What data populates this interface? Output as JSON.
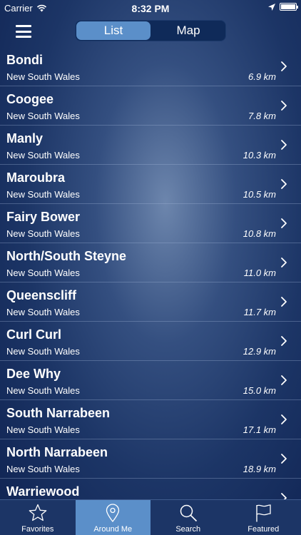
{
  "status": {
    "carrier": "Carrier",
    "time": "8:32 PM"
  },
  "nav": {
    "segments": [
      {
        "label": "List",
        "active": true
      },
      {
        "label": "Map",
        "active": false
      }
    ]
  },
  "beaches": [
    {
      "name": "Bondi",
      "region": "New South Wales",
      "distance": "6.9 km"
    },
    {
      "name": "Coogee",
      "region": "New South Wales",
      "distance": "7.8 km"
    },
    {
      "name": "Manly",
      "region": "New South Wales",
      "distance": "10.3 km"
    },
    {
      "name": "Maroubra",
      "region": "New South Wales",
      "distance": "10.5 km"
    },
    {
      "name": "Fairy Bower",
      "region": "New South Wales",
      "distance": "10.8 km"
    },
    {
      "name": "North/South Steyne",
      "region": "New South Wales",
      "distance": "11.0 km"
    },
    {
      "name": "Queenscliff",
      "region": "New South Wales",
      "distance": "11.7 km"
    },
    {
      "name": "Curl Curl",
      "region": "New South Wales",
      "distance": "12.9 km"
    },
    {
      "name": "Dee Why",
      "region": "New South Wales",
      "distance": "15.0 km"
    },
    {
      "name": "South Narrabeen",
      "region": "New South Wales",
      "distance": "17.1 km"
    },
    {
      "name": "North Narrabeen",
      "region": "New South Wales",
      "distance": "18.9 km"
    },
    {
      "name": "Warriewood",
      "region": "",
      "distance": ""
    }
  ],
  "tabs": [
    {
      "label": "Favorites",
      "icon": "star-icon",
      "active": false
    },
    {
      "label": "Around Me",
      "icon": "location-pin-icon",
      "active": true
    },
    {
      "label": "Search",
      "icon": "search-icon",
      "active": false
    },
    {
      "label": "Featured",
      "icon": "flag-icon",
      "active": false
    }
  ]
}
